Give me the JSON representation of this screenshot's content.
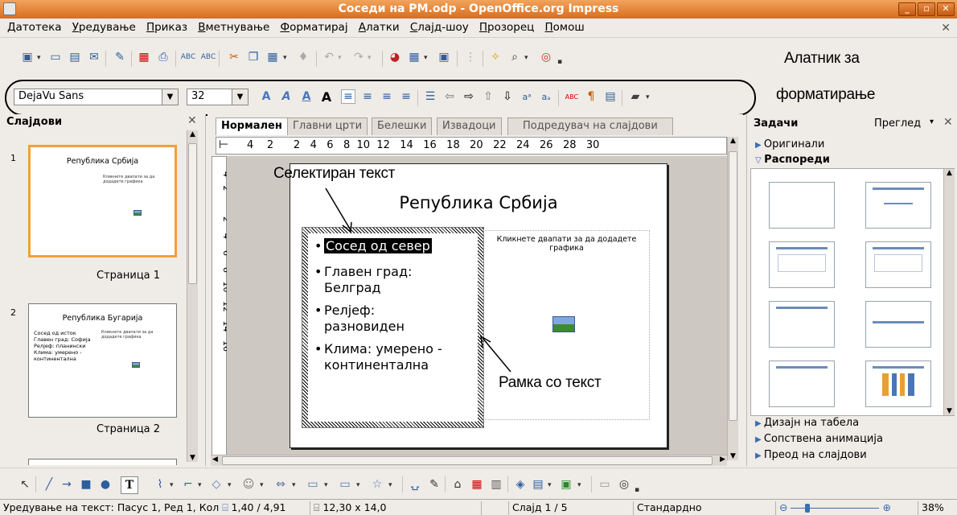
{
  "window": {
    "title": "Соседи на PM.odp - OpenOffice.org Impress"
  },
  "menu": [
    "Датотека",
    "Уредување",
    "Приказ",
    "Вметнување",
    "Форматирај",
    "Алатки",
    "Слајд-шоу",
    "Прозорец",
    "Помош"
  ],
  "format_toolbar": {
    "font_name": "DejaVu Sans",
    "font_size": "32"
  },
  "annotations": {
    "toolbar_line1": "Алатник за",
    "toolbar_line2": "форматирање",
    "selected_text": "Селектиран текст",
    "text_frame": "Рамка со текст"
  },
  "slides_panel": {
    "title": "Слајдови",
    "slides": [
      {
        "num": "1",
        "title": "Република Србија",
        "label": "Страница 1"
      },
      {
        "num": "2",
        "title": "Република Бугарија",
        "label": "Страница 2",
        "bullets": [
          "Сосед од исток",
          "Главен град: Софија",
          "Релјеф: планински",
          "Клима: умерено - континентална"
        ]
      }
    ]
  },
  "tabs": [
    "Нормален",
    "Главни црти",
    "Белешки",
    "Извадоци",
    "Подредувач на слајдови"
  ],
  "ruler": [
    "4",
    "2",
    "2",
    "4",
    "6",
    "8",
    "10",
    "12",
    "14",
    "16",
    "18",
    "20",
    "22",
    "24",
    "26",
    "28",
    "30"
  ],
  "vruler": [
    "4",
    "2",
    "2",
    "4",
    "6",
    "8",
    "10",
    "12",
    "14",
    "16"
  ],
  "slide": {
    "title": "Република Србија",
    "bullets": [
      "Сосед од север",
      "Главен град:",
      "Белград",
      "Релјеф:",
      "разновиден",
      "Клима: умерено -",
      "континентална"
    ],
    "graphic_hint": "Кликнете двапати за да додадете графика"
  },
  "tasks": {
    "title": "Задачи",
    "view": "Преглед",
    "sections": [
      "Оригинали",
      "Распореди",
      "Дизајн на табела",
      "Сопствена анимација",
      "Преод на слајдови"
    ]
  },
  "status": {
    "edit": "Уредување на текст: Пасус 1, Ред 1, Кол",
    "position": "1,40 / 4,91",
    "size": "12,30 x 14,0",
    "slide": "Слајд 1 / 5",
    "master": "Стандардно",
    "zoom": "38%"
  }
}
